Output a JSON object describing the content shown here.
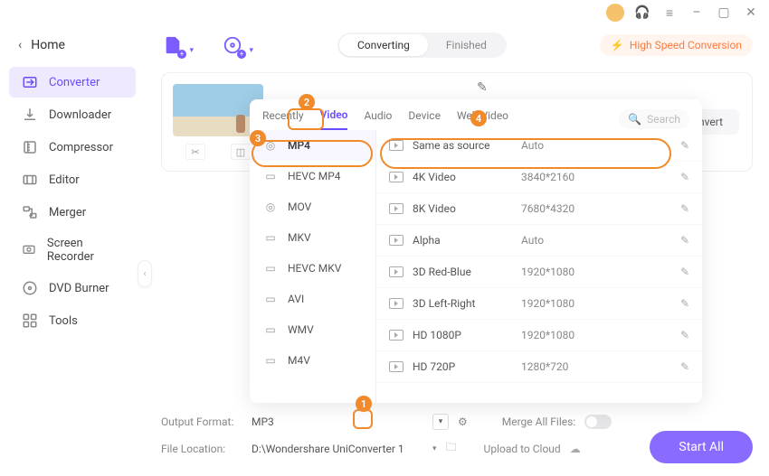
{
  "titlebar": {
    "min": "–",
    "max": "▢",
    "close": "✕",
    "menu": "≡",
    "support": "🎧"
  },
  "sidebar": {
    "home": "Home",
    "items": [
      {
        "label": "Converter"
      },
      {
        "label": "Downloader"
      },
      {
        "label": "Compressor"
      },
      {
        "label": "Editor"
      },
      {
        "label": "Merger"
      },
      {
        "label": "Screen Recorder"
      },
      {
        "label": "DVD Burner"
      },
      {
        "label": "Tools"
      }
    ]
  },
  "toolbar": {
    "seg_converting": "Converting",
    "seg_finished": "Finished",
    "speed_label": "High Speed Conversion"
  },
  "card": {
    "convert_label": "nvert"
  },
  "format_panel": {
    "tabs": [
      "Recently",
      "Video",
      "Audio",
      "Device",
      "Web Video"
    ],
    "active_tab": 1,
    "search_placeholder": "Search",
    "left": [
      {
        "label": "MP4"
      },
      {
        "label": "HEVC MP4"
      },
      {
        "label": "MOV"
      },
      {
        "label": "MKV"
      },
      {
        "label": "HEVC MKV"
      },
      {
        "label": "AVI"
      },
      {
        "label": "WMV"
      },
      {
        "label": "M4V"
      }
    ],
    "active_left": 0,
    "right": [
      {
        "label": "Same as source",
        "res": "Auto"
      },
      {
        "label": "4K Video",
        "res": "3840*2160"
      },
      {
        "label": "8K Video",
        "res": "7680*4320"
      },
      {
        "label": "Alpha",
        "res": "Auto"
      },
      {
        "label": "3D Red-Blue",
        "res": "1920*1080"
      },
      {
        "label": "3D Left-Right",
        "res": "1920*1080"
      },
      {
        "label": "HD 1080P",
        "res": "1920*1080"
      },
      {
        "label": "HD 720P",
        "res": "1280*720"
      }
    ]
  },
  "annotations": {
    "n1": "1",
    "n2": "2",
    "n3": "3",
    "n4": "4"
  },
  "footer": {
    "output_format_label": "Output Format:",
    "output_format_value": "MP3",
    "merge_label": "Merge All Files:",
    "file_loc_label": "File Location:",
    "file_loc_value": "D:\\Wondershare UniConverter 1",
    "upload_label": "Upload to Cloud",
    "start_all": "Start All"
  }
}
